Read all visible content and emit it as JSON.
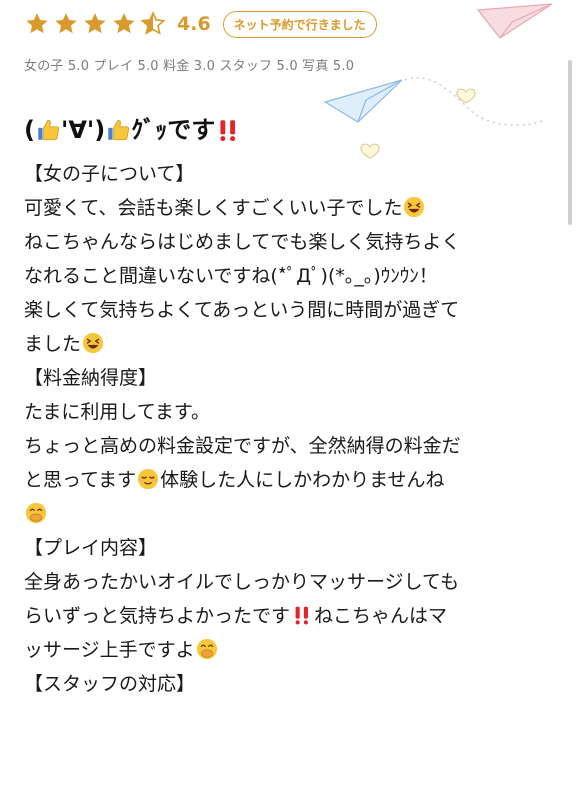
{
  "header": {
    "rating": "4.6",
    "stars_filled": 4.6,
    "badge_label": "ネット予約で行きました"
  },
  "subratings": "女の子 5.0 プレイ 5.0 料金 3.0 スタッフ 5.0 写真 5.0",
  "title": {
    "paren_open": "(",
    "face": "'∀'",
    "paren_close": ")",
    "goo": "ｸﾞｯです"
  },
  "body": {
    "l1": "【女の子について】",
    "l2": "可愛くて、会話も楽しくすごくいい子でした",
    "l3": "ねこちゃんならはじめましてでも楽しく気持ちよく",
    "l4": "なれること間違いないですね(*ﾟДﾟ)(*｡_｡)ｳﾝｳﾝ！",
    "l5": "楽しくて気持ちよくてあっという間に時間が過ぎて",
    "l6": "ました",
    "l7": "【料金納得度】",
    "l8": "たまに利用してます。",
    "l9": "ちょっと高めの料金設定ですが、全然納得の料金だ",
    "l10a": "と思ってます",
    "l10b": "体験した人にしかわかりませんね",
    "l12": "【プレイ内容】",
    "l13": "全身あったかいオイルでしっかりマッサージしても",
    "l14a": "らいずっと気持ちよかったです",
    "l14b": "ねこちゃんはマ",
    "l15": "ッサージ上手ですよ",
    "l16": "【スタッフの対応】"
  },
  "colors": {
    "accent": "#d99a2b",
    "emoji_yellow": "#f8c63b",
    "exclaim_red": "#e0262c",
    "deco_blue": "#b9d6ef",
    "deco_pink": "#f6c6cf"
  },
  "icons": [
    "star-icon",
    "thumbs-up-icon",
    "laughing-emoji",
    "relieved-emoji",
    "hand-over-mouth-emoji",
    "double-exclamation-icon",
    "paper-plane-icon",
    "heart-icon"
  ]
}
